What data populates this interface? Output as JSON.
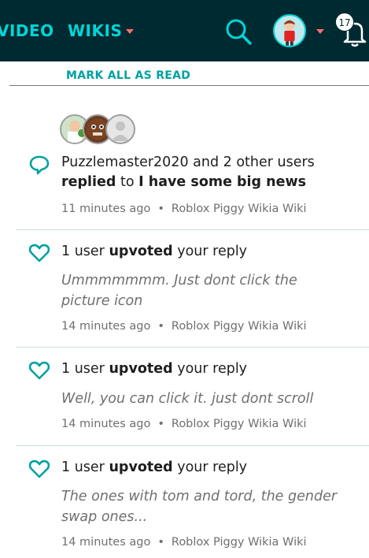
{
  "header": {
    "nav_video": "VIDEO",
    "nav_wikis": "WIKIS",
    "notification_count": "17"
  },
  "mark_all_label": "MARK ALL AS READ",
  "colors": {
    "header_bg": "#002a32",
    "accent": "#00d6d6",
    "caret": "#ff6e6e",
    "mark_all": "#00a1a1"
  },
  "notifications": [
    {
      "type": "reply",
      "icon": "speech-bubble-icon",
      "actor": "Puzzlemaster2020 and 2 other users",
      "verb": "replied",
      "connector": "to",
      "target": "I have some big news",
      "time": "11 minutes ago",
      "wiki": "Roblox Piggy Wikia Wiki"
    },
    {
      "type": "upvote",
      "icon": "heart-icon",
      "actor": "1 user",
      "verb": "upvoted",
      "target": "your reply",
      "quote": "Ummmmmmm. Just dont click the picture icon",
      "time": "14 minutes ago",
      "wiki": "Roblox Piggy Wikia Wiki"
    },
    {
      "type": "upvote",
      "icon": "heart-icon",
      "actor": "1 user",
      "verb": "upvoted",
      "target": "your reply",
      "quote": "Well, you can click it. just dont scroll",
      "time": "14 minutes ago",
      "wiki": "Roblox Piggy Wikia Wiki"
    },
    {
      "type": "upvote",
      "icon": "heart-icon",
      "actor": "1 user",
      "verb": "upvoted",
      "target": "your reply",
      "quote": "The ones with tom and tord, the gender swap ones...",
      "time": "14 minutes ago",
      "wiki": "Roblox Piggy Wikia Wiki"
    }
  ]
}
